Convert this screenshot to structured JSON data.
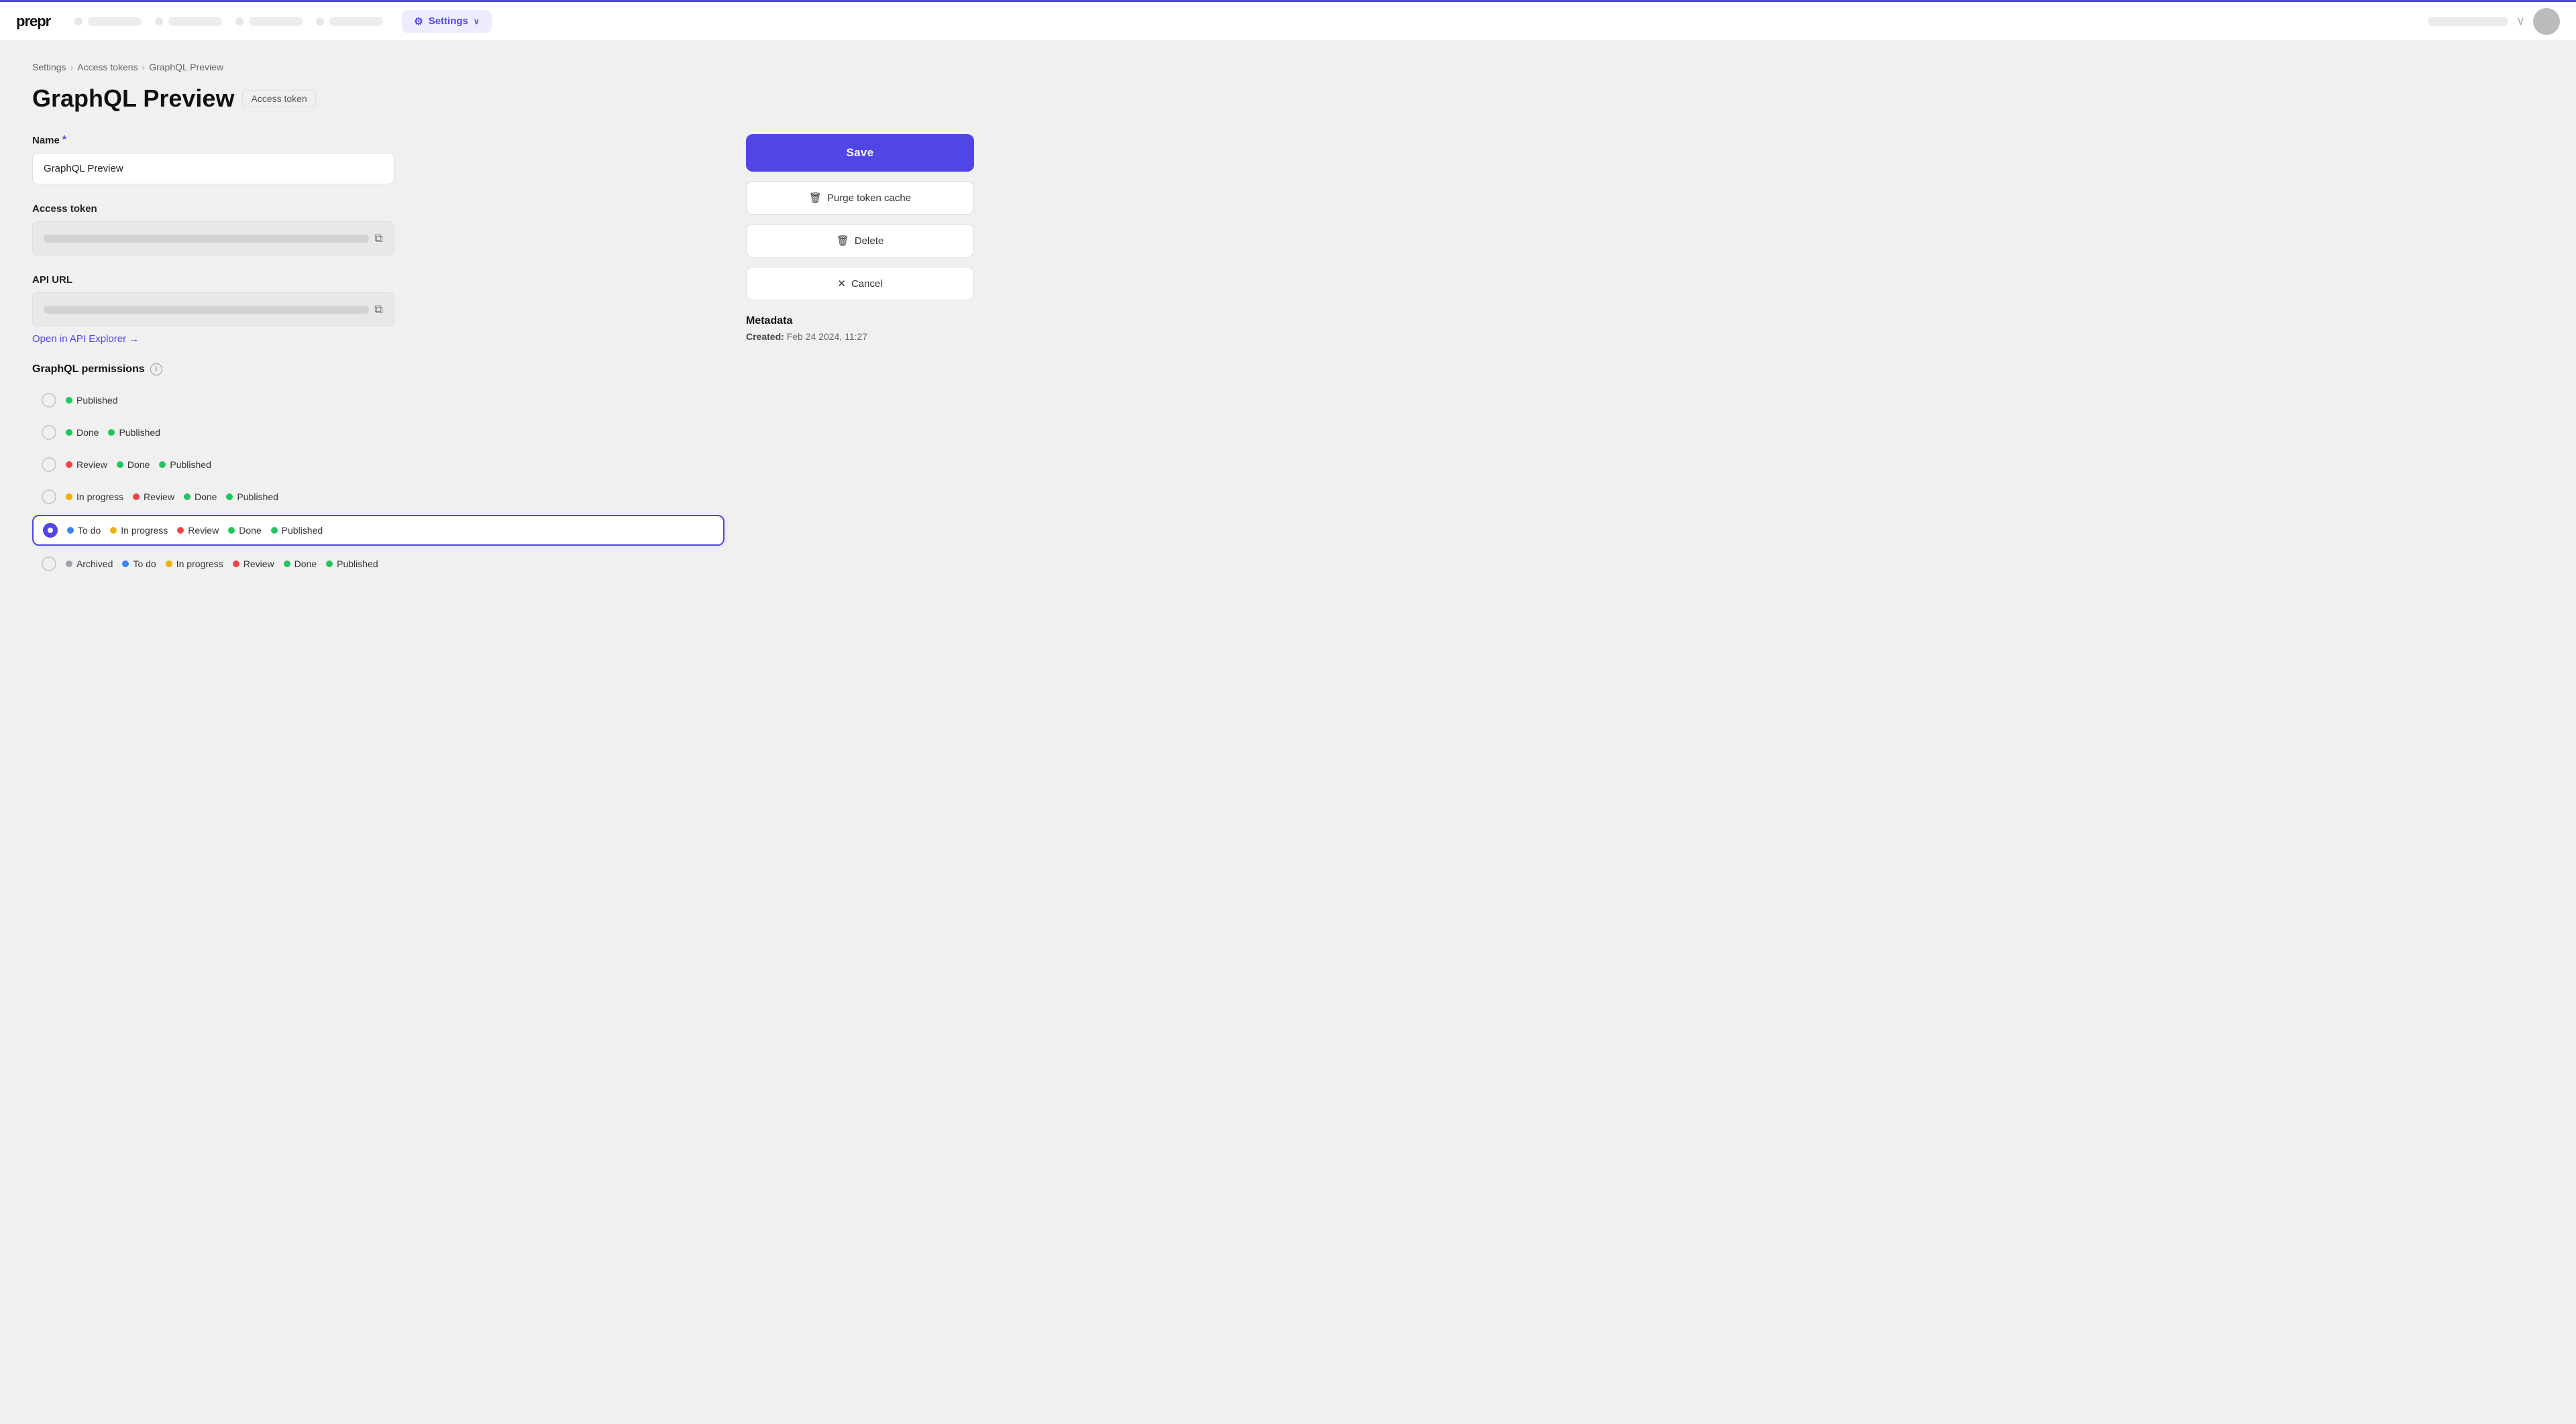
{
  "topnav": {
    "logo": "prepr",
    "settings_tab_label": "Settings",
    "chevron": "∨"
  },
  "breadcrumb": {
    "items": [
      {
        "label": "Settings",
        "href": "#"
      },
      {
        "label": "Access tokens",
        "href": "#"
      },
      {
        "label": "GraphQL Preview",
        "href": "#"
      }
    ]
  },
  "page_title": "GraphQL Preview",
  "badge_label": "Access token",
  "fields": {
    "name_label": "Name",
    "name_required": "*",
    "name_value": "GraphQL Preview",
    "name_placeholder": "GraphQL Preview",
    "access_token_label": "Access token",
    "api_url_label": "API URL",
    "api_explorer_text": "Open in API Explorer →"
  },
  "permissions": {
    "section_label": "GraphQL permissions",
    "info_icon": "i",
    "rows": [
      {
        "selected": false,
        "tags": [
          {
            "color": "green",
            "label": "Published"
          }
        ]
      },
      {
        "selected": false,
        "tags": [
          {
            "color": "green",
            "label": "Done"
          },
          {
            "color": "green",
            "label": "Published"
          }
        ]
      },
      {
        "selected": false,
        "tags": [
          {
            "color": "red",
            "label": "Review"
          },
          {
            "color": "green",
            "label": "Done"
          },
          {
            "color": "green",
            "label": "Published"
          }
        ]
      },
      {
        "selected": false,
        "tags": [
          {
            "color": "yellow",
            "label": "In progress"
          },
          {
            "color": "red",
            "label": "Review"
          },
          {
            "color": "green",
            "label": "Done"
          },
          {
            "color": "green",
            "label": "Published"
          }
        ]
      },
      {
        "selected": true,
        "tags": [
          {
            "color": "blue",
            "label": "To do"
          },
          {
            "color": "yellow",
            "label": "In progress"
          },
          {
            "color": "red",
            "label": "Review"
          },
          {
            "color": "green",
            "label": "Done"
          },
          {
            "color": "green",
            "label": "Published"
          }
        ]
      },
      {
        "selected": false,
        "tags": [
          {
            "color": "gray",
            "label": "Archived"
          },
          {
            "color": "blue",
            "label": "To do"
          },
          {
            "color": "yellow",
            "label": "In progress"
          },
          {
            "color": "red",
            "label": "Review"
          },
          {
            "color": "green",
            "label": "Done"
          },
          {
            "color": "green",
            "label": "Published"
          }
        ]
      }
    ]
  },
  "sidebar": {
    "save_label": "Save",
    "purge_label": "Purge token cache",
    "delete_label": "Delete",
    "cancel_label": "Cancel",
    "metadata_title": "Metadata",
    "created_label": "Created:",
    "created_value": "Feb 24 2024, 11:27"
  }
}
